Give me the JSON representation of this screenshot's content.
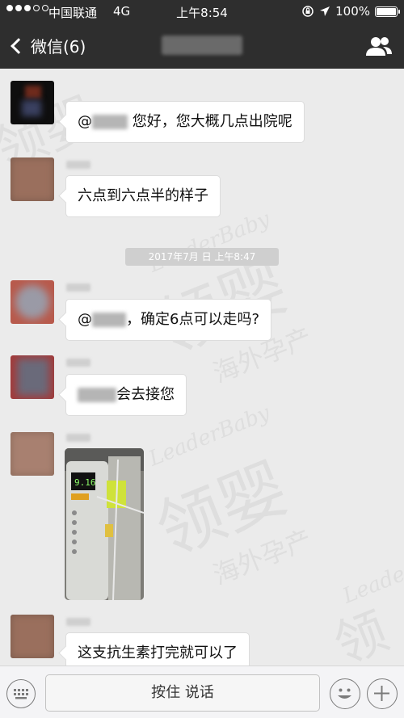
{
  "status_bar": {
    "carrier": "中国联通",
    "network": "4G",
    "time": "上午8:54",
    "battery": "100%",
    "battery_level": 1.0
  },
  "nav": {
    "back_label": "微信(6)",
    "back_icon": "chevron-left-icon",
    "right_icon": "group-people-icon"
  },
  "timestamp": "2017年7月 日 上午8:47",
  "messages": [
    {
      "prefix": "@",
      "text": "您好，您大概几点出院呢"
    },
    {
      "text": "六点到六点半的样子"
    },
    {
      "prefix": "@",
      "text": "，确定6点可以走吗?"
    },
    {
      "text": "会去接您"
    },
    {
      "image": "infusion-pump-photo"
    },
    {
      "text": "这支抗生素打完就可以了"
    }
  ],
  "input_bar": {
    "hold_to_talk": "按住 说话",
    "keyboard_icon": "keyboard-icon",
    "emoji_icon": "emoji-icon",
    "plus_icon": "plus-icon"
  },
  "watermark": {
    "brand": "LeaderBaby",
    "name": "领婴",
    "tagline": "海外孕产"
  },
  "colors": {
    "bar": "#2e2e2e",
    "chat_bg": "#ebebeb",
    "bubble": "#ffffff"
  }
}
